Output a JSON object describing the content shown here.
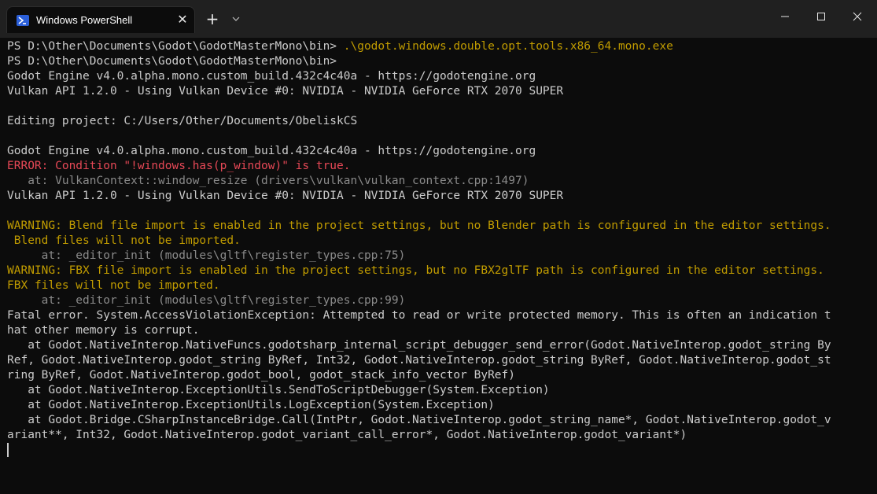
{
  "window": {
    "tab_title": "Windows PowerShell",
    "tab_icon": "powershell-icon",
    "tab_close": "✕",
    "new_tab": "+",
    "dropdown": "⌄",
    "controls": {
      "minimize": "minimize-icon",
      "maximize": "maximize-icon",
      "close": "close-icon"
    }
  },
  "terminal": {
    "lines": [
      {
        "parts": [
          {
            "text": "PS D:\\Other\\Documents\\Godot\\GodotMasterMono\\bin> "
          },
          {
            "text": ".\\godot.windows.double.opt.tools.x86_64.mono.exe",
            "cls": "warn"
          }
        ]
      },
      {
        "parts": [
          {
            "text": "PS D:\\Other\\Documents\\Godot\\GodotMasterMono\\bin>"
          }
        ]
      },
      {
        "parts": [
          {
            "text": "Godot Engine v4.0.alpha.mono.custom_build.432c4c40a - https://godotengine.org"
          }
        ]
      },
      {
        "parts": [
          {
            "text": "Vulkan API 1.2.0 - Using Vulkan Device #0: NVIDIA - NVIDIA GeForce RTX 2070 SUPER"
          }
        ]
      },
      {
        "parts": [
          {
            "text": ""
          }
        ]
      },
      {
        "parts": [
          {
            "text": "Editing project: C:/Users/Other/Documents/ObeliskCS"
          }
        ]
      },
      {
        "parts": [
          {
            "text": ""
          }
        ]
      },
      {
        "parts": [
          {
            "text": "Godot Engine v4.0.alpha.mono.custom_build.432c4c40a - https://godotengine.org"
          }
        ]
      },
      {
        "parts": [
          {
            "text": "ERROR: ",
            "cls": "err"
          },
          {
            "text": "Condition \"!windows.has(p_window)\" is true.",
            "cls": "err"
          }
        ]
      },
      {
        "parts": [
          {
            "text": "   at: VulkanContext::window_resize (drivers\\vulkan\\vulkan_context.cpp:1497)",
            "cls": "dim"
          }
        ]
      },
      {
        "parts": [
          {
            "text": "Vulkan API 1.2.0 - Using Vulkan Device #0: NVIDIA - NVIDIA GeForce RTX 2070 SUPER"
          }
        ]
      },
      {
        "parts": [
          {
            "text": ""
          }
        ]
      },
      {
        "parts": [
          {
            "text": "WARNING: Blend file import is enabled in the project settings, but no Blender path is configured in the editor settings.",
            "cls": "warn"
          }
        ]
      },
      {
        "parts": [
          {
            "text": " Blend files will not be imported.",
            "cls": "warn"
          }
        ]
      },
      {
        "parts": [
          {
            "text": "     at: _editor_init (modules\\gltf\\register_types.cpp:75)",
            "cls": "dim"
          }
        ]
      },
      {
        "parts": [
          {
            "text": "WARNING: FBX file import is enabled in the project settings, but no FBX2glTF path is configured in the editor settings.",
            "cls": "warn"
          }
        ]
      },
      {
        "parts": [
          {
            "text": "FBX files will not be imported.",
            "cls": "warn"
          }
        ]
      },
      {
        "parts": [
          {
            "text": "     at: _editor_init (modules\\gltf\\register_types.cpp:99)",
            "cls": "dim"
          }
        ]
      },
      {
        "parts": [
          {
            "text": "Fatal error. System.AccessViolationException: Attempted to read or write protected memory. This is often an indication t"
          }
        ]
      },
      {
        "parts": [
          {
            "text": "hat other memory is corrupt."
          }
        ]
      },
      {
        "parts": [
          {
            "text": "   at Godot.NativeInterop.NativeFuncs.godotsharp_internal_script_debugger_send_error(Godot.NativeInterop.godot_string By"
          }
        ]
      },
      {
        "parts": [
          {
            "text": "Ref, Godot.NativeInterop.godot_string ByRef, Int32, Godot.NativeInterop.godot_string ByRef, Godot.NativeInterop.godot_st"
          }
        ]
      },
      {
        "parts": [
          {
            "text": "ring ByRef, Godot.NativeInterop.godot_bool, godot_stack_info_vector ByRef)"
          }
        ]
      },
      {
        "parts": [
          {
            "text": "   at Godot.NativeInterop.ExceptionUtils.SendToScriptDebugger(System.Exception)"
          }
        ]
      },
      {
        "parts": [
          {
            "text": "   at Godot.NativeInterop.ExceptionUtils.LogException(System.Exception)"
          }
        ]
      },
      {
        "parts": [
          {
            "text": "   at Godot.Bridge.CSharpInstanceBridge.Call(IntPtr, Godot.NativeInterop.godot_string_name*, Godot.NativeInterop.godot_v"
          }
        ]
      },
      {
        "parts": [
          {
            "text": "ariant**, Int32, Godot.NativeInterop.godot_variant_call_error*, Godot.NativeInterop.godot_variant*)"
          }
        ]
      }
    ]
  }
}
